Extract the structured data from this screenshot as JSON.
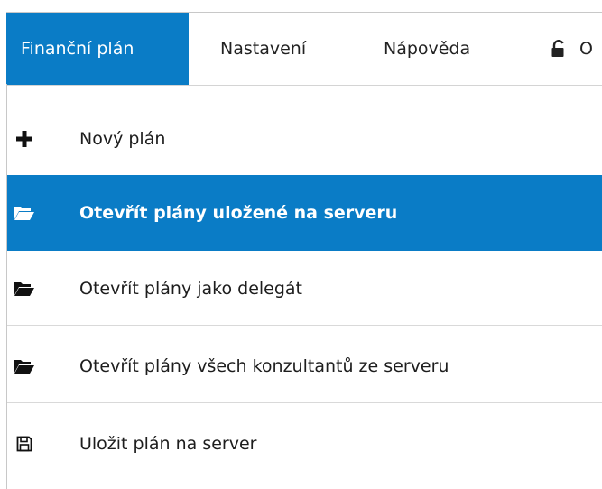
{
  "menubar": {
    "tabs": [
      {
        "label": "Finanční plán"
      },
      {
        "label": "Nastavení"
      },
      {
        "label": "Nápověda"
      },
      {
        "label": "O",
        "icon": "lock-icon"
      }
    ]
  },
  "menu": {
    "items": [
      {
        "label": "Nový plán",
        "icon": "plus-icon"
      },
      {
        "label": "Otevřít plány uložené na serveru",
        "icon": "folder-open-icon"
      },
      {
        "label": "Otevřít plány jako delegát",
        "icon": "folder-open-icon"
      },
      {
        "label": "Otevřít plány všech konzultantů ze serveru",
        "icon": "folder-open-icon"
      },
      {
        "label": "Uložit plán na server",
        "icon": "save-icon"
      }
    ]
  },
  "colors": {
    "accent": "#0a7cc6",
    "text": "#1d1d1d",
    "divider": "#d9d9d9"
  }
}
